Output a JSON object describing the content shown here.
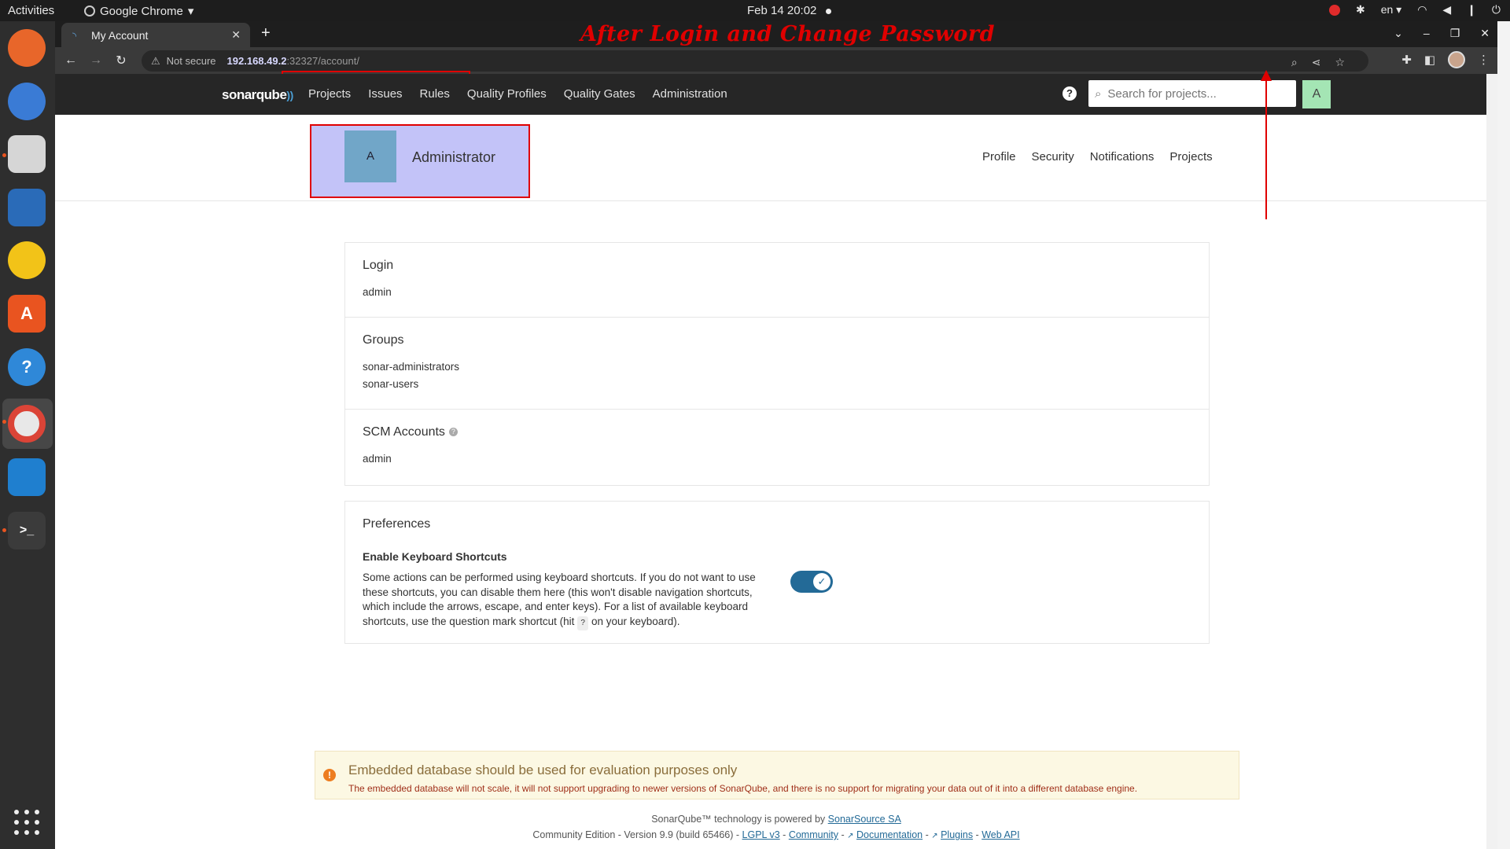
{
  "system": {
    "activities": "Activities",
    "app_name": "Google Chrome",
    "clock": "Feb 14  20:02",
    "language": "en"
  },
  "browser": {
    "tab_title": "My Account",
    "annotation_title": "After Login and Change Password",
    "security_label": "Not secure",
    "url_host": "192.168.49.2",
    "url_path": ":32327/account/"
  },
  "sonar_nav": {
    "logo": "sonarqube",
    "links": [
      "Projects",
      "Issues",
      "Rules",
      "Quality Profiles",
      "Quality Gates",
      "Administration"
    ],
    "search_placeholder": "Search for projects...",
    "user_initial": "A"
  },
  "account": {
    "avatar_initial": "A",
    "name": "Administrator",
    "tabs": [
      "Profile",
      "Security",
      "Notifications",
      "Projects"
    ]
  },
  "profile": {
    "login_title": "Login",
    "login_value": "admin",
    "groups_title": "Groups",
    "groups": [
      "sonar-administrators",
      "sonar-users"
    ],
    "scm_title": "SCM Accounts",
    "scm_value": "admin"
  },
  "preferences": {
    "title": "Preferences",
    "option_title": "Enable Keyboard Shortcuts",
    "desc_before": "Some actions can be performed using keyboard shortcuts. If you do not want to use these shortcuts, you can disable them here (this won't disable navigation shortcuts, which include the arrows, escape, and enter keys). For a list of available keyboard shortcuts, use the question mark shortcut (hit",
    "desc_key": "?",
    "desc_after": "on your keyboard).",
    "enabled": true
  },
  "banner": {
    "title": "Embedded database should be used for evaluation purposes only",
    "text": "The embedded database will not scale, it will not support upgrading to newer versions of SonarQube, and there is no support for migrating your data out of it into a different database engine."
  },
  "footer": {
    "powered_prefix": "SonarQube™ technology is powered by",
    "powered_link": "SonarSource SA",
    "edition": "Community Edition - Version 9.9 (build 65466) -",
    "links": [
      "LGPL v3",
      "Community",
      "Documentation",
      "Plugins",
      "Web API"
    ]
  },
  "colors": {
    "annotation_red": "#e00000",
    "sonar_nav_bg": "#262626",
    "toggle_blue": "#236a97",
    "user_badge": "#a4e5b4"
  }
}
